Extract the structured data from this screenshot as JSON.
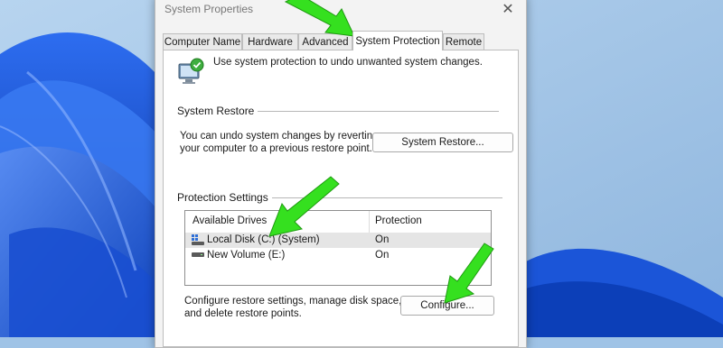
{
  "dialog": {
    "title": "System Properties",
    "close_glyph": "✕"
  },
  "tabs": [
    {
      "label": "Computer Name"
    },
    {
      "label": "Hardware"
    },
    {
      "label": "Advanced"
    },
    {
      "label": "System Protection",
      "active": true
    },
    {
      "label": "Remote"
    }
  ],
  "intro": {
    "text": "Use system protection to undo unwanted system changes.",
    "icon": "system-protection-icon"
  },
  "system_restore": {
    "group_label": "System Restore",
    "description_line1": "You can undo system changes by reverting",
    "description_line2": "your computer to a previous restore point.",
    "button_label": "System Restore..."
  },
  "protection_settings": {
    "group_label": "Protection Settings",
    "columns": [
      "Available Drives",
      "Protection"
    ],
    "drives": [
      {
        "name": "Local Disk (C:) (System)",
        "protection": "On",
        "icon": "windows-drive-icon",
        "selected": true
      },
      {
        "name": "New Volume (E:)",
        "protection": "On",
        "icon": "drive-icon",
        "selected": false
      }
    ],
    "configure_line1": "Configure restore settings, manage disk space,",
    "configure_line2": "and delete restore points.",
    "configure_button": "Configure..."
  },
  "annotations": {
    "arrow_color": "#35e01f",
    "arrow_count": 3
  },
  "colors": {
    "desktop_accent": "#1554d6",
    "desktop_bg": "#9fc3e6",
    "dialog_bg": "#f3f3f3"
  }
}
